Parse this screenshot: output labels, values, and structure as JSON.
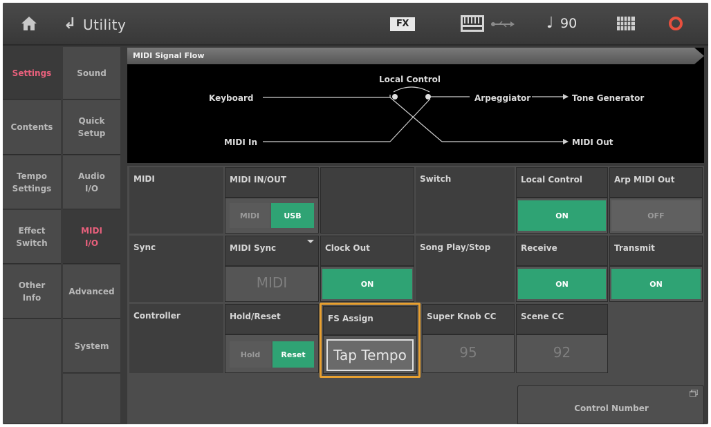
{
  "topbar": {
    "back_glyph": "↲",
    "title": "Utility",
    "fx_badge": "FX",
    "tempo": "90",
    "note_glyph": "♩"
  },
  "nav": {
    "col1": [
      "Settings",
      "Contents",
      "Tempo\nSettings",
      "Effect\nSwitch",
      "Other\nInfo"
    ],
    "col2": [
      "Sound",
      "Quick\nSetup",
      "Audio\nI/O",
      "MIDI\nI/O",
      "Advanced",
      "System"
    ],
    "active_col1": "Settings",
    "active_col2": "MIDI I/O"
  },
  "flow": {
    "title": "MIDI Signal Flow",
    "keyboard": "Keyboard",
    "local_control": "Local Control",
    "arpeggiator": "Arpeggiator",
    "tone_generator": "Tone Generator",
    "midi_in": "MIDI In",
    "midi_out": "MIDI Out"
  },
  "params": {
    "midi_section": "MIDI",
    "midi_inout_label": "MIDI IN/OUT",
    "midi_option": "MIDI",
    "usb_option": "USB",
    "switch_section": "Switch",
    "local_control_label": "Local Control",
    "local_control_value": "ON",
    "arp_midi_out_label": "Arp MIDI Out",
    "arp_midi_out_value": "OFF",
    "sync_section": "Sync",
    "midi_sync_label": "MIDI Sync",
    "midi_sync_value": "MIDI",
    "clock_out_label": "Clock Out",
    "clock_out_value": "ON",
    "song_play_stop_section": "Song Play/Stop",
    "receive_label": "Receive",
    "receive_value": "ON",
    "transmit_label": "Transmit",
    "transmit_value": "ON",
    "controller_section": "Controller",
    "hold_reset_label": "Hold/Reset",
    "hold_option": "Hold",
    "reset_option": "Reset",
    "fs_assign_label": "FS Assign",
    "fs_assign_value": "Tap Tempo",
    "super_knob_cc_label": "Super Knob CC",
    "super_knob_cc_value": "95",
    "scene_cc_label": "Scene CC",
    "scene_cc_value": "92",
    "control_number_label": "Control Number"
  },
  "colors": {
    "on_green": "#2fa374",
    "active_pink": "#e8607c",
    "highlight_orange": "#e8a030"
  }
}
